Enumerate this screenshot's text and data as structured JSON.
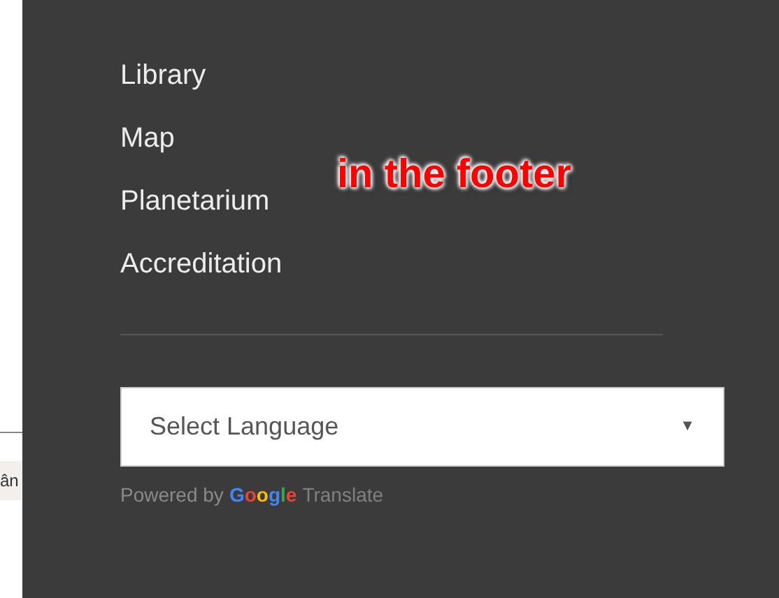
{
  "left_fragment": {
    "text": "ân"
  },
  "footer": {
    "links": [
      {
        "label": "Library"
      },
      {
        "label": "Map"
      },
      {
        "label": "Planetarium"
      },
      {
        "label": "Accreditation"
      }
    ],
    "annotation": "in the footer",
    "language_select": {
      "value": "Select Language",
      "arrow": "▼"
    },
    "powered_by": {
      "prefix": "Powered by",
      "logo": "Google",
      "suffix": "Translate"
    }
  }
}
